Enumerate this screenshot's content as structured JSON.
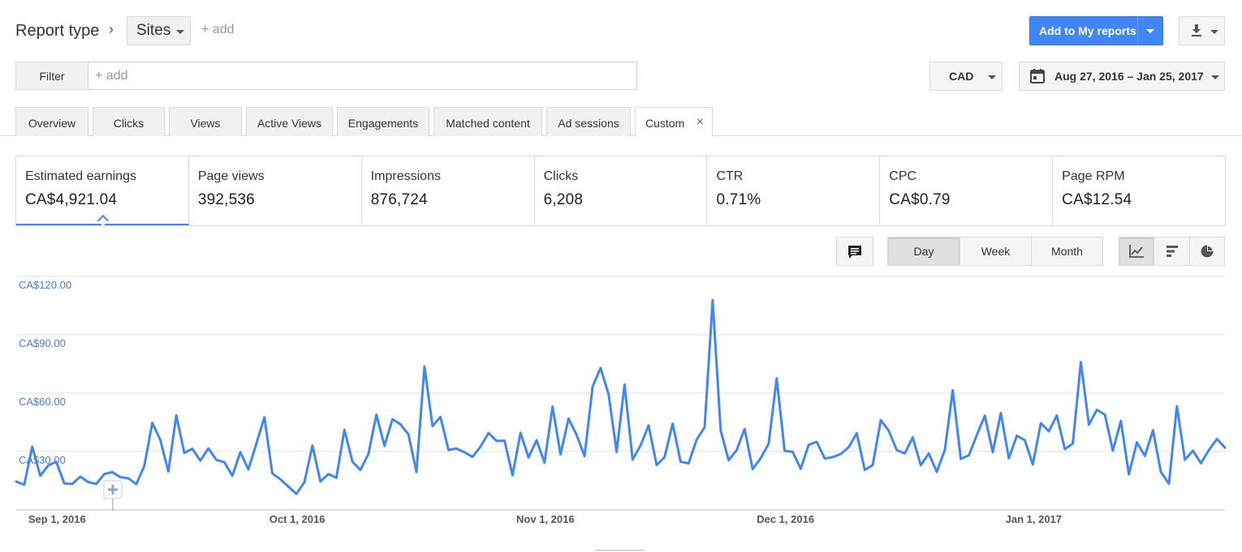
{
  "header": {
    "title": "Report type",
    "breadcrumb_sep": "›",
    "dimension": "Sites",
    "add_label": "+ add",
    "add_reports_label": "Add to My reports",
    "download_icon": "download-icon"
  },
  "filter": {
    "button_label": "Filter",
    "placeholder": "+ add"
  },
  "currency": "CAD",
  "date_range": "Aug 27, 2016 – Jan 25, 2017",
  "tabs": [
    {
      "label": "Overview"
    },
    {
      "label": "Clicks"
    },
    {
      "label": "Views"
    },
    {
      "label": "Active Views"
    },
    {
      "label": "Engagements"
    },
    {
      "label": "Matched content"
    },
    {
      "label": "Ad sessions"
    },
    {
      "label": "Custom",
      "active": true,
      "close": "×"
    }
  ],
  "metrics": [
    {
      "name": "Estimated earnings",
      "value": "CA$4,921.04",
      "selected": true
    },
    {
      "name": "Page views",
      "value": "392,536"
    },
    {
      "name": "Impressions",
      "value": "876,724"
    },
    {
      "name": "Clicks",
      "value": "6,208"
    },
    {
      "name": "CTR",
      "value": "0.71%"
    },
    {
      "name": "CPC",
      "value": "CA$0.79"
    },
    {
      "name": "Page RPM",
      "value": "CA$12.54"
    }
  ],
  "granularity": {
    "options": [
      "Day",
      "Week",
      "Month"
    ],
    "selected": "Day"
  },
  "chart_types": {
    "options": [
      "line-chart-icon",
      "bar-chart-icon",
      "pie-chart-icon"
    ],
    "selected": "line-chart-icon"
  },
  "colors": {
    "accent": "#4285f4",
    "axis_label": "#4a7bd8"
  },
  "chart_data": {
    "type": "line",
    "x_start": "2016-08-27",
    "x_end": "2017-01-25",
    "xlabel": "",
    "ylabel": "",
    "ylim": [
      0,
      120
    ],
    "y_ticks": [
      "CA$30.00",
      "CA$60.00",
      "CA$90.00",
      "CA$120.00"
    ],
    "x_ticks": [
      "Sep 1, 2016",
      "Oct 1, 2016",
      "Nov 1, 2016",
      "Dec 1, 2016",
      "Jan 1, 2017"
    ],
    "grid": true,
    "series": [
      {
        "values": [
          14.5,
          12.9,
          32.5,
          17.5,
          22.8,
          24.7,
          13.6,
          13.3,
          17.1,
          14.3,
          13.3,
          18.4,
          19.4,
          16.8,
          16.2,
          13.2,
          22.6,
          44.7,
          35.9,
          19.7,
          48.6,
          29.2,
          31.4,
          25.3,
          31.6,
          25.7,
          24.5,
          17.5,
          29.7,
          20.8,
          34.0,
          47.6,
          18.7,
          15.7,
          11.9,
          8.2,
          14.2,
          33.1,
          14.6,
          18.4,
          16.5,
          41.1,
          24.7,
          20.5,
          28.8,
          48.9,
          32.9,
          46.6,
          44.0,
          38.7,
          19.4,
          73.7,
          43.1,
          47.8,
          30.8,
          31.5,
          29.6,
          27.2,
          32.5,
          39.5,
          35.4,
          35.6,
          17.7,
          39.6,
          26.9,
          35.8,
          24.3,
          53.1,
          28.5,
          46.9,
          38.6,
          27.6,
          63.3,
          72.9,
          59.5,
          29.8,
          64.4,
          25.8,
          33.2,
          43.4,
          23.0,
          27.1,
          44.3,
          24.7,
          23.9,
          36.1,
          42.4,
          107.8,
          40.8,
          25.5,
          30.7,
          41.6,
          20.9,
          26.6,
          34.0,
          67.6,
          30.3,
          29.8,
          21.1,
          33.4,
          35.0,
          26.4,
          27.1,
          28.7,
          32.2,
          39.4,
          20.5,
          23.0,
          46.1,
          40.7,
          30.7,
          29.0,
          37.3,
          22.9,
          29.0,
          19.5,
          30.7,
          61.5,
          26.2,
          28.0,
          38.4,
          48.4,
          29.6,
          49.8,
          26.5,
          38.1,
          35.8,
          23.3,
          44.6,
          40.4,
          48.5,
          31.2,
          34.1,
          75.9,
          43.8,
          51.4,
          48.9,
          30.4,
          45.7,
          18.2,
          34.7,
          27.7,
          40.9,
          19.5,
          13.4,
          53.3,
          25.7,
          30.4,
          23.9,
          30.8,
          36.4,
          32.0
        ]
      }
    ]
  }
}
